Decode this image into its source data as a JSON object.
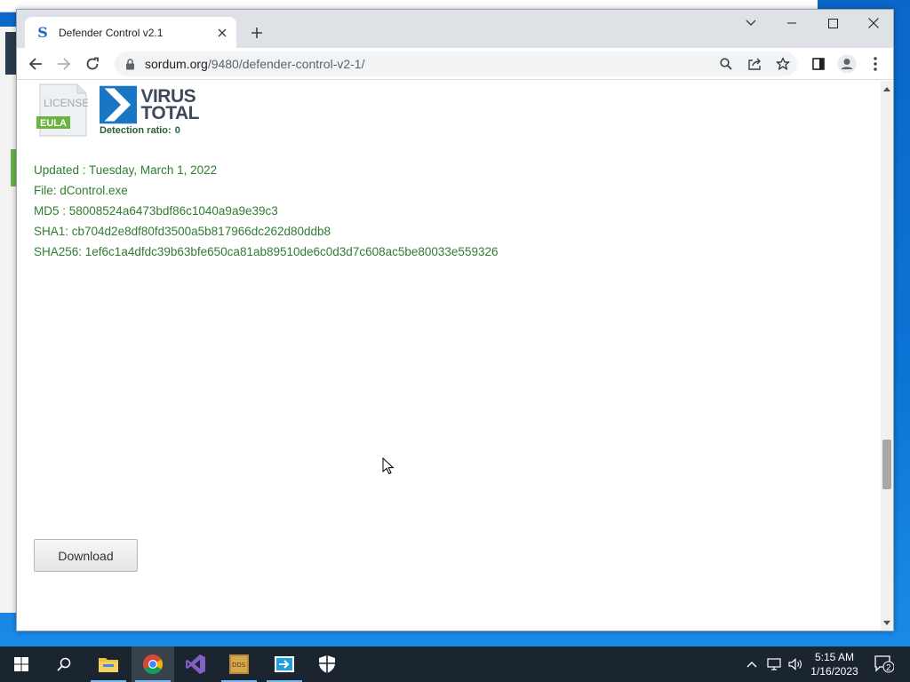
{
  "browser": {
    "tab": {
      "title": "Defender Control v2.1",
      "favicon_letter": "S"
    },
    "url": {
      "host": "sordum.org",
      "path": "/9480/defender-control-v2-1/"
    }
  },
  "page": {
    "license_badge": {
      "top": "LICENSE",
      "bottom": "EULA"
    },
    "virustotal": {
      "logo_line1": "VIRUS",
      "logo_line2": "TOTAL",
      "detection_label": "Detection ratio:",
      "detection_value": "0"
    },
    "file_info": {
      "updated": "Updated : Tuesday, March 1, 2022",
      "file": "File: dControl.exe",
      "md5": "MD5 : 58008524a6473bdf86c1040a9a9e39c3",
      "sha1": "SHA1: cb704d2e8df80fd3500a5b817966dc262d80ddb8",
      "sha256": "SHA256: 1ef6c1a4dfdc39b63bfe650ca81ab89510de6c0d3d7c608ac5be80033e559326"
    },
    "download_label": "Download"
  },
  "taskbar": {
    "clock_time": "5:15 AM",
    "clock_date": "1/16/2023",
    "notification_count": "2"
  },
  "colors": {
    "accent_green": "#2e7d32",
    "taskbar": "#1b2530",
    "tab_strip": "#dee1e6"
  }
}
